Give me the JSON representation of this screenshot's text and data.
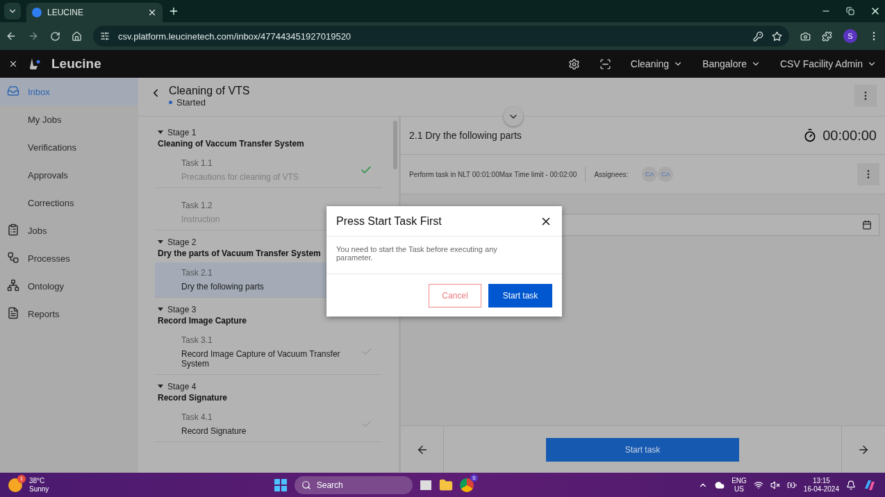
{
  "browser": {
    "tab_title": "LEUCINE",
    "url": "csv.platform.leucinetech.com/inbox/477443451927019520",
    "profile": "S"
  },
  "app_header": {
    "brand": "Leucine",
    "menus": [
      "Cleaning",
      "Bangalore",
      "CSV Facility Admin"
    ]
  },
  "sidebar": {
    "items": [
      {
        "label": "Inbox",
        "selected": true
      },
      {
        "label": "My Jobs",
        "selected": false
      },
      {
        "label": "Verifications",
        "selected": false
      },
      {
        "label": "Approvals",
        "selected": false
      },
      {
        "label": "Corrections",
        "selected": false
      },
      {
        "label": "Jobs",
        "selected": false
      },
      {
        "label": "Processes",
        "selected": false
      },
      {
        "label": "Ontology",
        "selected": false
      },
      {
        "label": "Reports",
        "selected": false
      }
    ]
  },
  "job": {
    "title": "Cleaning of VTS",
    "status": "Started"
  },
  "stages": [
    {
      "label": "Stage 1",
      "name": "Cleaning of Vaccum Transfer System",
      "expanded": true,
      "tasks": [
        {
          "number": "Task 1.1",
          "name": "Precautions for cleaning of VTS",
          "selected": false,
          "disabled": true,
          "kind": "checkable",
          "completed": true
        },
        {
          "number": "Task 1.2",
          "name": "Instruction",
          "selected": false,
          "disabled": true,
          "kind": "plain"
        }
      ]
    },
    {
      "label": "Stage 2",
      "name": "Dry the parts of Vacuum Transfer System",
      "expanded": true,
      "tasks": [
        {
          "number": "Task 2.1",
          "name": "Dry the following parts",
          "selected": true,
          "disabled": false,
          "kind": "plain"
        }
      ]
    },
    {
      "label": "Stage 3",
      "name": "Record Image Capture",
      "expanded": true,
      "tasks": [
        {
          "number": "Task 3.1",
          "name": "Record Image Capture of Vacuum Transfer System",
          "selected": false,
          "disabled": false,
          "kind": "checkable",
          "completed": false
        }
      ]
    },
    {
      "label": "Stage 4",
      "name": "Record Signature",
      "expanded": true,
      "tasks": [
        {
          "number": "Task 4.1",
          "name": "Record Signature",
          "selected": false,
          "disabled": false,
          "kind": "checkable",
          "completed": false
        }
      ]
    }
  ],
  "task_panel": {
    "title": "2.1 Dry the following parts",
    "timer": "00:00:00",
    "timing": "Perform task in NLT 00:01:00Max Time limit - 00:02:00",
    "assignees_label": "Assignees:",
    "assignees": [
      "CA",
      "CA"
    ],
    "footer_button": "Start task"
  },
  "dialog": {
    "title": "Press Start Task First",
    "message": "You need to start the Task before executing any parameter.",
    "cancel": "Cancel",
    "confirm": "Start task"
  },
  "taskbar": {
    "temperature": "38°C",
    "condition": "Sunny",
    "weather_badge": "1",
    "search": "Search",
    "chrome_badge": "S",
    "language": "ENG",
    "region": "US",
    "time": "13:15",
    "date": "16-04-2024"
  }
}
